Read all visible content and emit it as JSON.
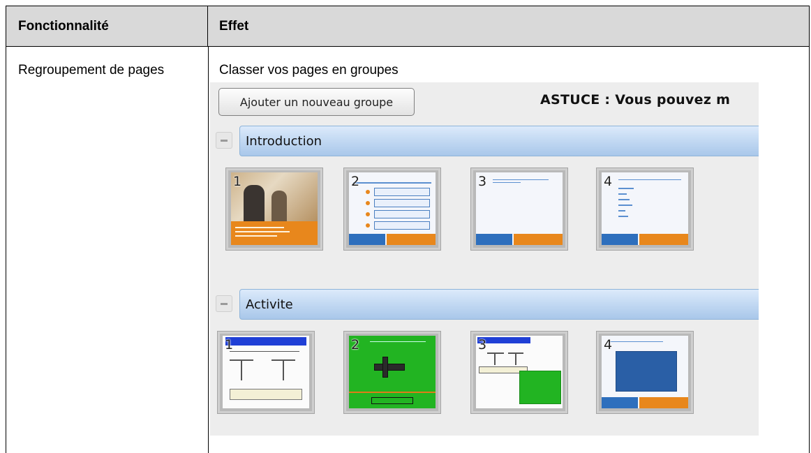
{
  "table": {
    "header": {
      "col1": "Fonctionnalité",
      "col2": "Effet"
    },
    "row": {
      "feature": "Regroupement de pages",
      "effect": "Classer vos pages en groupes"
    }
  },
  "screenshot": {
    "add_group_button": "Ajouter un nouveau groupe",
    "tip": "ASTUCE : Vous pouvez m",
    "groups": [
      {
        "name": "Introduction",
        "pages": [
          "1",
          "2",
          "3",
          "4"
        ]
      },
      {
        "name": "Activite",
        "pages": [
          "1",
          "2",
          "3",
          "4"
        ]
      }
    ]
  }
}
